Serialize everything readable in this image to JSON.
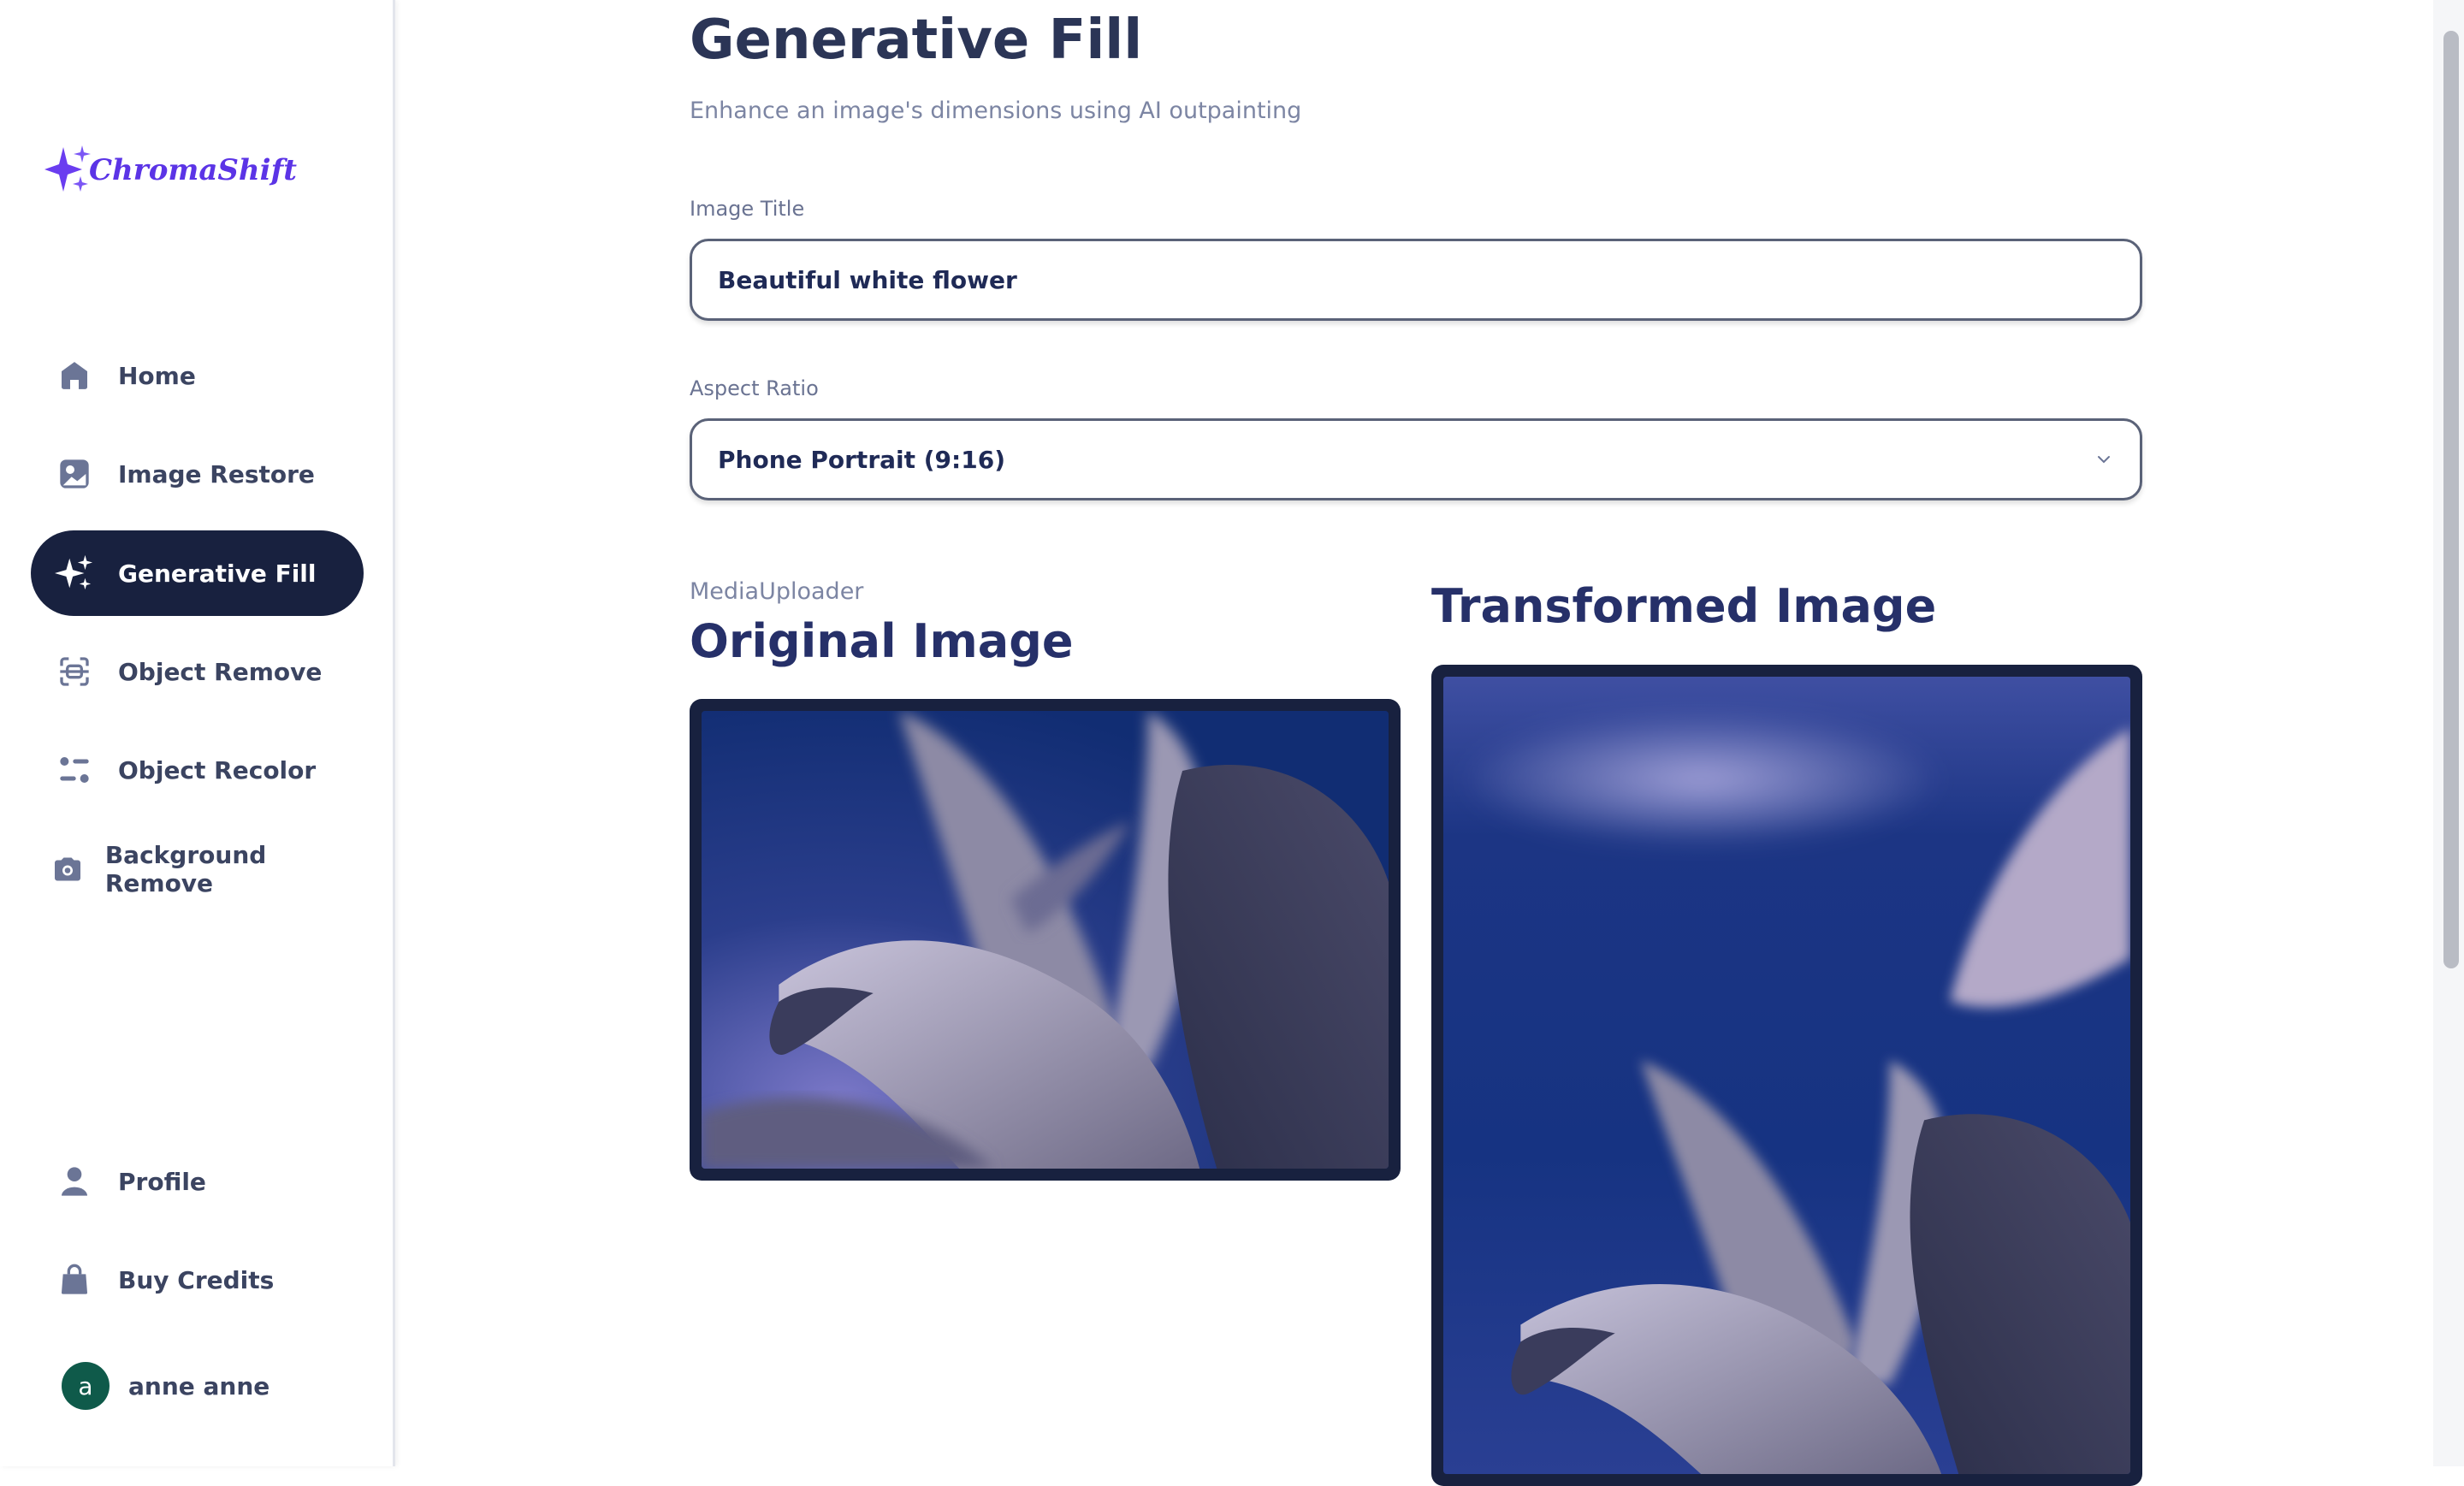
{
  "app": {
    "logo_text": "ChromaShift"
  },
  "sidebar": {
    "items": [
      {
        "label": "Home",
        "icon": "home-icon",
        "active": false
      },
      {
        "label": "Image Restore",
        "icon": "image-icon",
        "active": false
      },
      {
        "label": "Generative Fill",
        "icon": "sparkles-icon",
        "active": true
      },
      {
        "label": "Object Remove",
        "icon": "scan-icon",
        "active": false
      },
      {
        "label": "Object Recolor",
        "icon": "filter-icon",
        "active": false
      },
      {
        "label": "Background Remove",
        "icon": "camera-icon",
        "active": false
      }
    ],
    "bottom_items": [
      {
        "label": "Profile",
        "icon": "user-icon"
      },
      {
        "label": "Buy Credits",
        "icon": "bag-icon"
      }
    ],
    "user": {
      "avatar_letter": "a",
      "name": "anne anne"
    }
  },
  "main": {
    "title": "Generative Fill",
    "subtitle": "Enhance an image's dimensions using AI outpainting",
    "image_title": {
      "label": "Image Title",
      "value": "Beautiful white flower"
    },
    "aspect_ratio": {
      "label": "Aspect Ratio",
      "value": "Phone Portrait (9:16)"
    },
    "media_uploader_label": "MediaUploader",
    "original_title": "Original Image",
    "transformed_title": "Transformed Image"
  },
  "colors": {
    "active_nav_bg": "#18213f",
    "title": "#2b3556",
    "section_title": "#263069",
    "avatar": "#0f5a4a",
    "logo": "#6a3df0"
  }
}
